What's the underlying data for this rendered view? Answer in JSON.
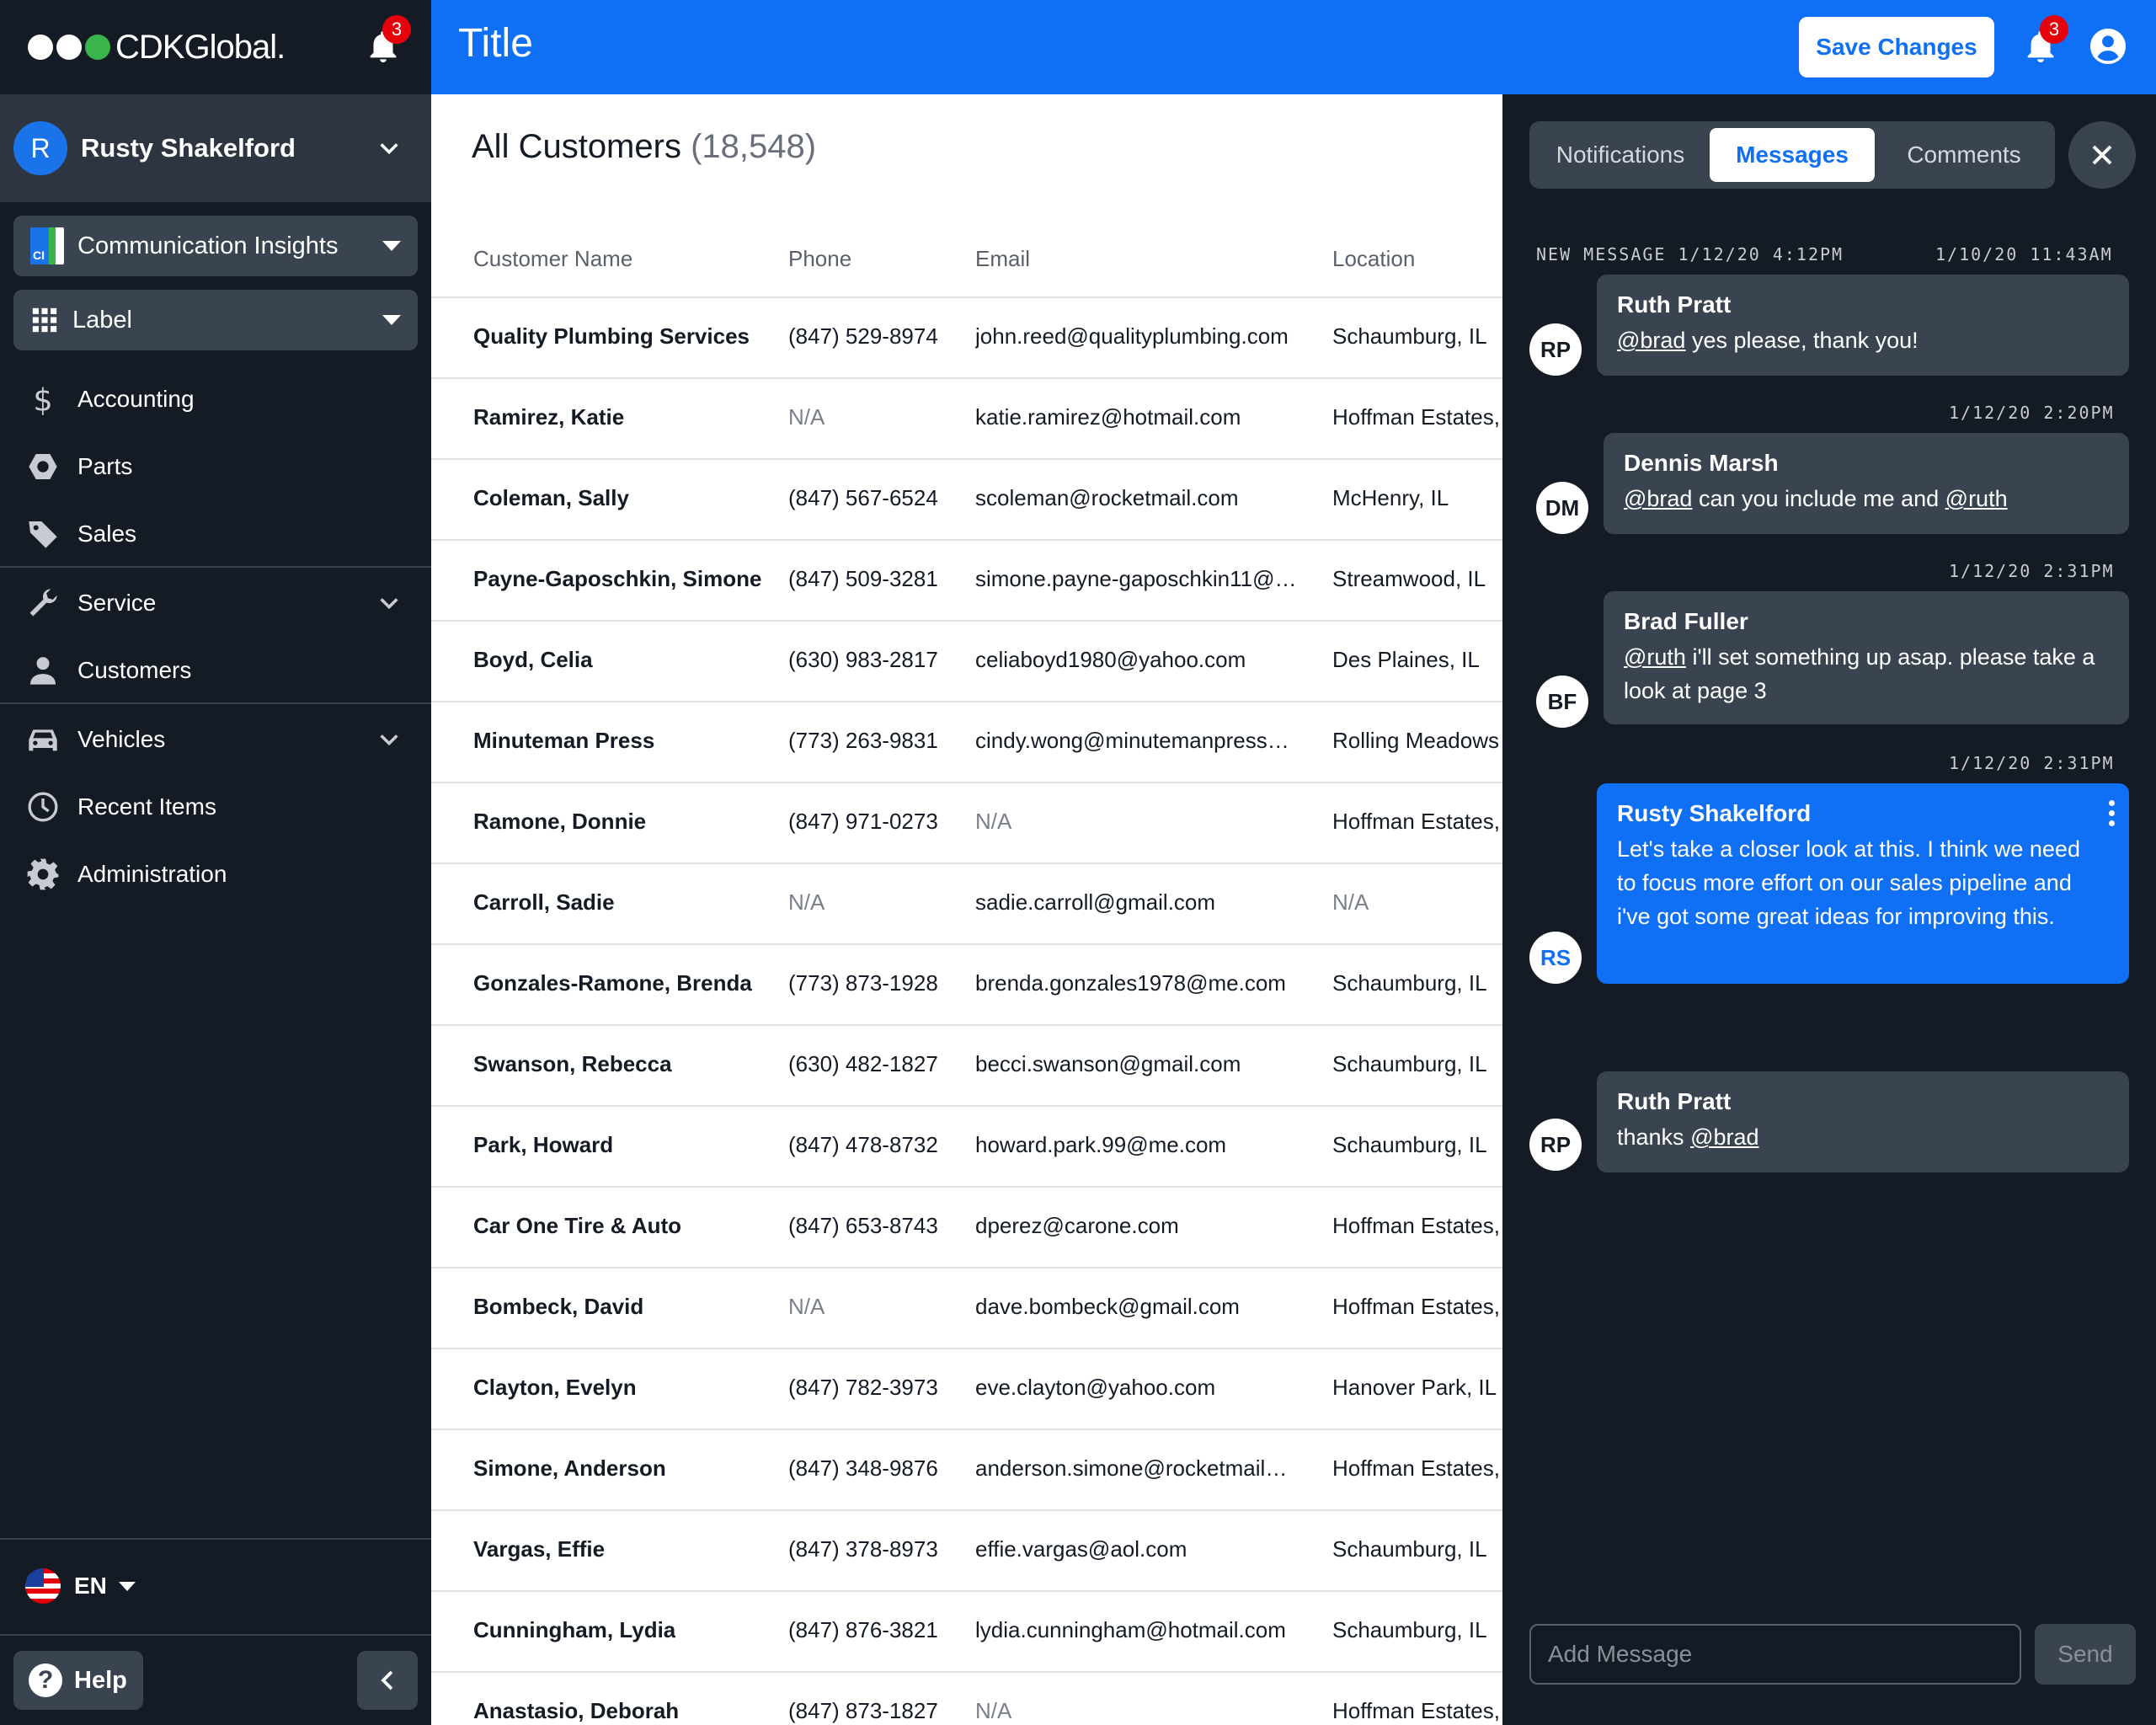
{
  "brand": {
    "name": "CDKGlobal.",
    "dot_colors": [
      "#ffffff",
      "#ffffff",
      "#39b54a"
    ]
  },
  "sidebar": {
    "notification_count": "3",
    "user": {
      "initial": "R",
      "name": "Rusty Shakelford"
    },
    "app_select": {
      "icon_text": "CI",
      "label": "Communication Insights"
    },
    "label_select": {
      "label": "Label"
    },
    "items": [
      {
        "label": "Accounting",
        "icon": "dollar-icon"
      },
      {
        "label": "Parts",
        "icon": "hexagon-nut-icon"
      },
      {
        "label": "Sales",
        "icon": "tag-icon"
      },
      {
        "label": "Service",
        "icon": "wrench-icon"
      },
      {
        "label": "Customers",
        "icon": "person-icon"
      },
      {
        "label": "Vehicles",
        "icon": "car-icon"
      },
      {
        "label": "Recent Items",
        "icon": "clock-icon"
      },
      {
        "label": "Administration",
        "icon": "gear-icon"
      }
    ],
    "language": "EN",
    "help_label": "Help"
  },
  "topbar": {
    "title": "Title",
    "save_label": "Save Changes",
    "notification_count": "3"
  },
  "main": {
    "heading": "All Customers",
    "count": "(18,548)",
    "columns": [
      "Customer Name",
      "Phone",
      "Email",
      "Location"
    ],
    "rows": [
      [
        "Quality Plumbing Services",
        "(847) 529-8974",
        "john.reed@qualityplumbing.com",
        "Schaumburg, IL"
      ],
      [
        "Ramirez, Katie",
        "N/A",
        "katie.ramirez@hotmail.com",
        "Hoffman Estates, IL"
      ],
      [
        "Coleman, Sally",
        "(847) 567-6524",
        "scoleman@rocketmail.com",
        "McHenry, IL"
      ],
      [
        "Payne-Gaposchkin, Simone",
        "(847) 509-3281",
        "simone.payne-gaposchkin11@…",
        "Streamwood, IL"
      ],
      [
        "Boyd, Celia",
        "(630) 983-2817",
        "celiaboyd1980@yahoo.com",
        "Des Plaines, IL"
      ],
      [
        "Minuteman Press",
        "(773) 263-9831",
        "cindy.wong@minutemanpress…",
        "Rolling Meadows, IL"
      ],
      [
        "Ramone, Donnie",
        "(847) 971-0273",
        "N/A",
        "Hoffman Estates, IL"
      ],
      [
        "Carroll, Sadie",
        "N/A",
        "sadie.carroll@gmail.com",
        "N/A"
      ],
      [
        "Gonzales-Ramone, Brenda",
        "(773) 873-1928",
        "brenda.gonzales1978@me.com",
        "Schaumburg, IL"
      ],
      [
        "Swanson, Rebecca",
        "(630) 482-1827",
        "becci.swanson@gmail.com",
        "Schaumburg, IL"
      ],
      [
        "Park, Howard",
        "(847) 478-8732",
        "howard.park.99@me.com",
        "Schaumburg, IL"
      ],
      [
        "Car One Tire & Auto",
        "(847) 653-8743",
        "dperez@carone.com",
        "Hoffman Estates, IL"
      ],
      [
        "Bombeck, David",
        "N/A",
        "dave.bombeck@gmail.com",
        "Hoffman Estates, IL"
      ],
      [
        "Clayton, Evelyn",
        "(847) 782-3973",
        "eve.clayton@yahoo.com",
        "Hanover Park, IL"
      ],
      [
        "Simone, Anderson",
        "(847) 348-9876",
        "anderson.simone@rocketmail…",
        "Hoffman Estates, IL"
      ],
      [
        "Vargas, Effie",
        "(847) 378-8973",
        "effie.vargas@aol.com",
        "Schaumburg, IL"
      ],
      [
        "Cunningham, Lydia",
        "(847) 876-3821",
        "lydia.cunningham@hotmail.com",
        "Schaumburg, IL"
      ],
      [
        "Anastasio, Deborah",
        "(847) 873-1827",
        "N/A",
        "Hoffman Estates, IL"
      ]
    ]
  },
  "panel": {
    "tabs": [
      "Notifications",
      "Messages",
      "Comments"
    ],
    "active_tab": "Messages",
    "new_message_label": "NEW MESSAGE 1/12/20  4:12PM",
    "messages": [
      {
        "stamp": "1/10/20 11:43AM",
        "initials": "RP",
        "sender": "Ruth Pratt",
        "mentions": [
          "@brad"
        ],
        "text": " yes please, thank you!"
      },
      {
        "stamp": "1/12/20 2:20PM",
        "initials": "DM",
        "sender": "Dennis Marsh",
        "mentions": [
          "@brad",
          "@ruth"
        ],
        "text_a": " can you include me and ",
        "text_b": ""
      },
      {
        "stamp": "1/12/20 2:31PM",
        "initials": "BF",
        "sender": "Brad Fuller",
        "mentions": [
          "@ruth"
        ],
        "text": " i'll set something up asap. please take a look at page 3"
      },
      {
        "stamp": "1/12/20 2:31PM",
        "initials": "RS",
        "sender": "Rusty Shakelford",
        "text": "Let's take a closer look at this. I think we need to focus more effort on our sales pipeline and i've got some great ideas for improving this."
      },
      {
        "initials": "RP",
        "sender": "Ruth Pratt",
        "text": "thanks ",
        "mentions": [
          "@brad"
        ]
      }
    ],
    "input_placeholder": "Add Message",
    "send_label": "Send"
  }
}
